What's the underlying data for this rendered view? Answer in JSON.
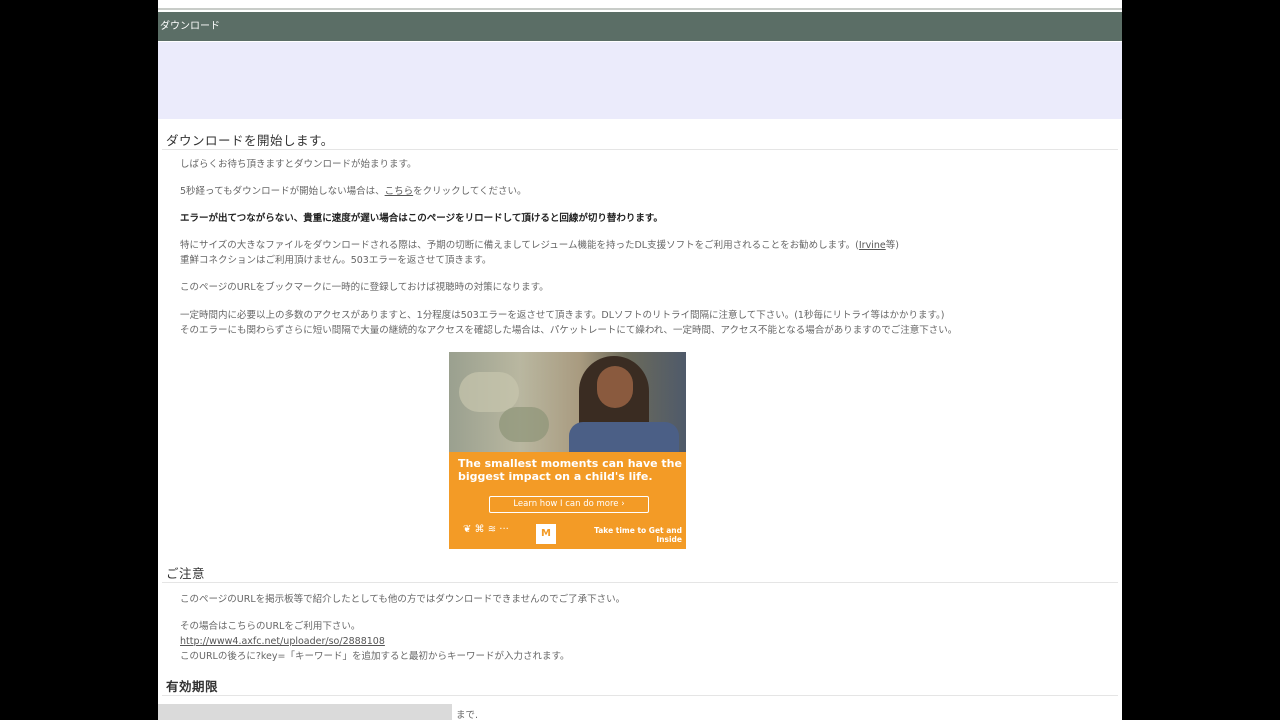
{
  "titlebar": {
    "text": "ダウンロード"
  },
  "download": {
    "heading": "ダウンロードを開始します。",
    "lines": [
      "しばらくお待ち頂きますとダウンロードが始まります。",
      "5秒経ってもダウンロードが開始しない場合は、",
      "エラーが出てつながらない、貴重に速度が遅い場合はこのページをリロードして頂けると回線が切り替わります。",
      "特にサイズの大きなファイルをダウンロードされる際は、予期の切断に備えましてレジューム機能を持ったDL支援ソフトをご利用されることをお勧めします。(",
      "重鮮コネクションはご利用頂けません。503エラーを返させて頂きます。",
      "このページのURLをブックマークに一時的に登録しておけば視聴時の対策になります。",
      "一定時間内に必要以上の多数のアクセスがありますと、1分程度は503エラーを返させて頂きます。DLソフトのリトライ間隔に注意して下さい。(1秒毎にリトライ等はかかります。)",
      "そのエラーにも関わらずさらに短い間隔で大量の継続的なアクセスを確認した場合は、パケットレートにて繰われ、一定時間、アクセス不能となる場合がありますのでご注意下さい。"
    ],
    "link_here": "こちら",
    "link_here_suffix": "をクリックしてください。",
    "link_irvine": "Irvine",
    "link_irvine_suffix": "等)"
  },
  "banner": {
    "headline": "The smallest moments can have the biggest impact on a child's life.",
    "cta": "Learn how I can do more ›",
    "logo": "❦ ⌘ ≋ ··· ",
    "box": "M",
    "tagline": "Take time to Get and Inside"
  },
  "caution": {
    "heading": "ご注意",
    "line1": "このページのURLを掲示板等で紹介したとしても他の方ではダウンロードできませんのでご了承下さい。",
    "line2": "その場合はこちらのURLをご利用下さい。",
    "url": "http://www4.axfc.net/uploader/so/2888108",
    "line3": "このURLの後ろに?key=「キーワード」を追加すると最初からキーワードが入力されます。"
  },
  "expiry": {
    "heading": "有効期限",
    "suffix": "まで."
  }
}
